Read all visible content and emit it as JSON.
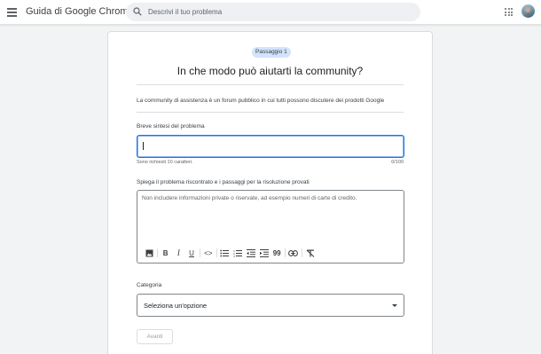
{
  "header": {
    "title": "Guida di Google Chrome",
    "search_placeholder": "Descrivi il tuo problema",
    "icons": {
      "menu": "menu-icon",
      "search": "search-icon",
      "apps": "apps-grid-icon",
      "avatar": "account-avatar"
    }
  },
  "form": {
    "step_badge": "Passaggio 1",
    "headline": "In che modo può aiutarti la community?",
    "intro": "La community di assistenza è un forum pubblico in cui tutti possono discutere dei prodotti Google",
    "summary": {
      "label": "Breve sintesi del problema",
      "value": "",
      "hint": "Sono richiesti 10 caratteri.",
      "counter": "0/100"
    },
    "details": {
      "label": "Spiega il problema riscontrato e i passaggi per la risoluzione provati",
      "placeholder": "Non includere informazioni private o riservate, ad esempio numeri di carte di credito.",
      "toolbar": [
        {
          "name": "image-icon",
          "glyph": ""
        },
        {
          "name": "bold-icon",
          "glyph": "B"
        },
        {
          "name": "italic-icon",
          "glyph": "I"
        },
        {
          "name": "underline-icon",
          "glyph": "U"
        },
        {
          "name": "code-icon",
          "glyph": "<>"
        },
        {
          "name": "bulleted-list-icon",
          "glyph": ""
        },
        {
          "name": "numbered-list-icon",
          "glyph": ""
        },
        {
          "name": "indent-decrease-icon",
          "glyph": ""
        },
        {
          "name": "indent-increase-icon",
          "glyph": ""
        },
        {
          "name": "quote-icon",
          "glyph": "99"
        },
        {
          "name": "link-icon",
          "glyph": ""
        },
        {
          "name": "clear-formatting-icon",
          "glyph": ""
        }
      ]
    },
    "category": {
      "label": "Categoria",
      "selected": "Seleziona un'opzione"
    },
    "next_button": "Avanti"
  },
  "colors": {
    "accent": "#1a73e8",
    "badge_bg": "#d2e3fc",
    "page_bg": "#f1f3f4"
  }
}
